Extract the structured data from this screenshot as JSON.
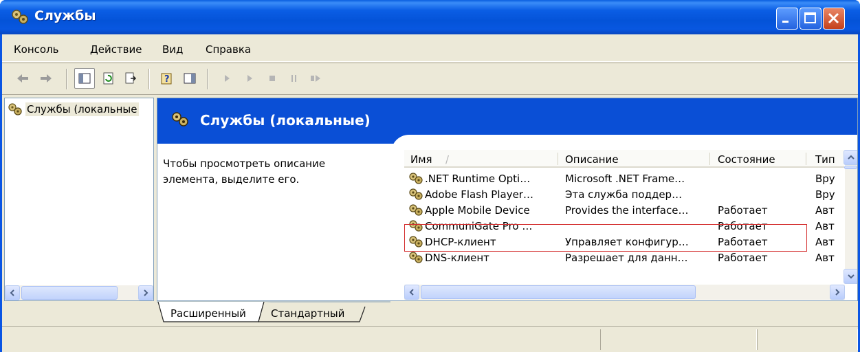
{
  "window": {
    "title": "Службы",
    "icon": "services-gear-icon"
  },
  "menu": [
    "Консоль",
    "Действие",
    "Вид",
    "Справка"
  ],
  "tree": {
    "item_label": "Службы (локальные"
  },
  "panel": {
    "header_title": "Службы (локальные)",
    "description_line1": "Чтобы просмотреть описание",
    "description_line2": "элемента, выделите его."
  },
  "list": {
    "columns": [
      "Имя",
      "Описание",
      "Состояние",
      "Тип"
    ],
    "sort_indicator": "/",
    "rows": [
      {
        "name": ".NET Runtime Opti…",
        "description": "Microsoft .NET Frame…",
        "status": "",
        "type": "Вру"
      },
      {
        "name": "Adobe Flash Player…",
        "description": "Эта служба поддер…",
        "status": "",
        "type": "Вру"
      },
      {
        "name": "Apple Mobile Device",
        "description": "Provides the interface…",
        "status": "Работает",
        "type": "Авт"
      },
      {
        "name": "CommuniGate Pro …",
        "description": "",
        "status": "Работает",
        "type": "Авт"
      },
      {
        "name": "DHCP-клиент",
        "description": "Управляет конфигур…",
        "status": "Работает",
        "type": "Авт"
      },
      {
        "name": "DNS-клиент",
        "description": "Разрешает для данн…",
        "status": "Работает",
        "type": "Авт"
      }
    ]
  },
  "tabs": [
    "Расширенный",
    "Стандартный"
  ],
  "colors": {
    "titlebar": "#0b5ee5",
    "header_band": "#0a4fd6",
    "highlight_border": "#d43030"
  }
}
